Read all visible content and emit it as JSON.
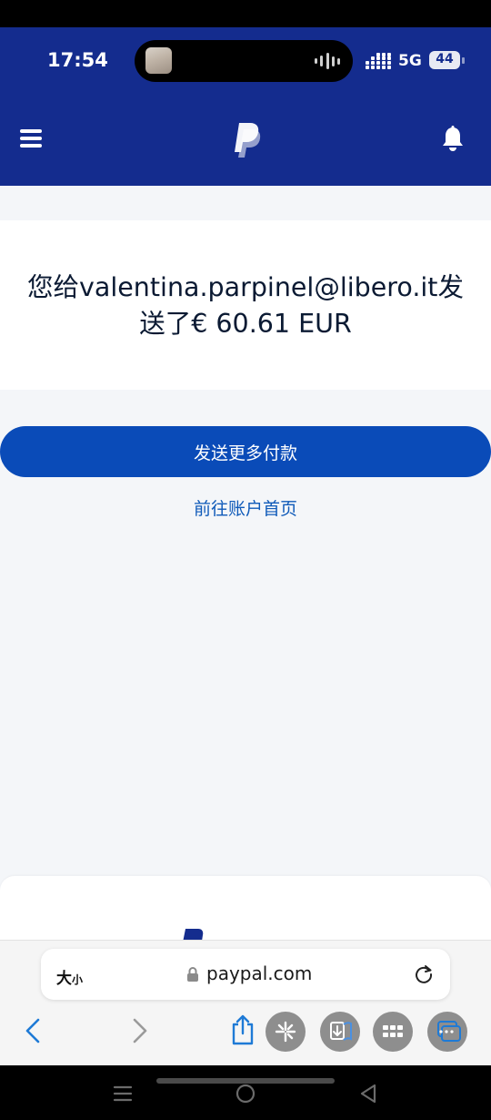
{
  "status_bar": {
    "time": "17:54",
    "network": "5G",
    "battery": "44",
    "icons": [
      "now-playing-thumbnail-icon",
      "audio-wave-icon",
      "signal-icon",
      "battery-icon"
    ]
  },
  "app_header": {
    "icons": [
      "menu-icon",
      "paypal-logo-icon",
      "notification-bell-icon"
    ],
    "colors": {
      "background": "#142c8e"
    }
  },
  "main": {
    "message": "您给valentina.parpinel@libero.it发送了€ 60.61 EUR",
    "primary_button_label": "发送更多付款",
    "home_link_label": "前往账户首页",
    "colors": {
      "button": "#0a4bb8",
      "link": "#0f5ab9",
      "background": "#f4f6f9"
    }
  },
  "browser": {
    "text_size_label_big": "大",
    "text_size_label_small": "小",
    "url": "paypal.com",
    "toolbar_icons": [
      "back-icon",
      "forward-icon",
      "share-icon",
      "ai-sparkle-icon",
      "bookmarks-icon",
      "apps-grid-icon",
      "tabs-icon"
    ]
  },
  "system_nav": {
    "icons": [
      "recents-icon",
      "home-icon",
      "back-triangle-icon"
    ]
  }
}
